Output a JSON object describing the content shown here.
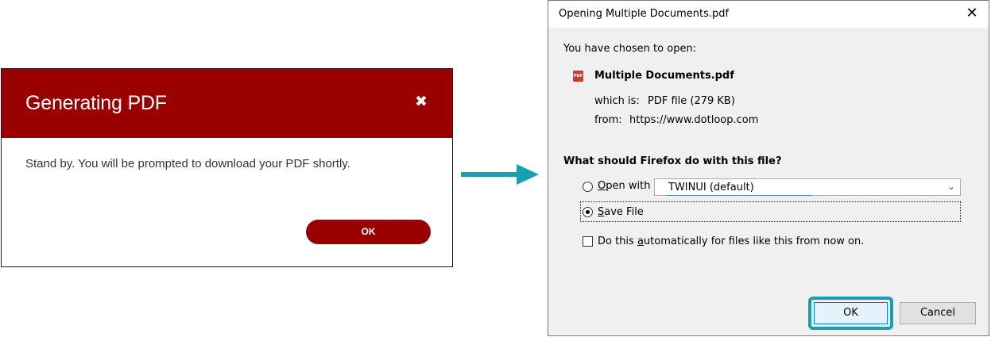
{
  "generating_modal": {
    "title": "Generating PDF",
    "close_glyph": "✖",
    "message": "Stand by. You will be prompted to download your PDF shortly.",
    "ok_label": "OK",
    "brand_color": "#990000"
  },
  "arrow": {
    "color": "#1a9fb0",
    "icon": "arrow-right-icon"
  },
  "firefox_dialog": {
    "title": "Opening Multiple Documents.pdf",
    "close_glyph": "✕",
    "chosen_label": "You have chosen to open:",
    "file_name": "Multiple Documents.pdf",
    "file_icon": "pdf-file-icon",
    "which_is_label": "which is:",
    "which_is_value": "PDF file (279 KB)",
    "from_label": "from:",
    "from_value": "https://www.dotloop.com",
    "question": "What should Firefox do with this file?",
    "open_with": {
      "label_underlined": "O",
      "label_rest": "pen with",
      "selected": false,
      "app_value": "TWINUI (default)"
    },
    "save_file": {
      "label_underlined": "S",
      "label_rest": "ave File",
      "selected": true
    },
    "auto_checkbox": {
      "label_before": "Do this ",
      "label_underlined": "a",
      "label_after": "utomatically for files like this from now on.",
      "checked": false
    },
    "ok_label": "OK",
    "cancel_label": "Cancel",
    "highlight_color": "#1a9fb0"
  }
}
